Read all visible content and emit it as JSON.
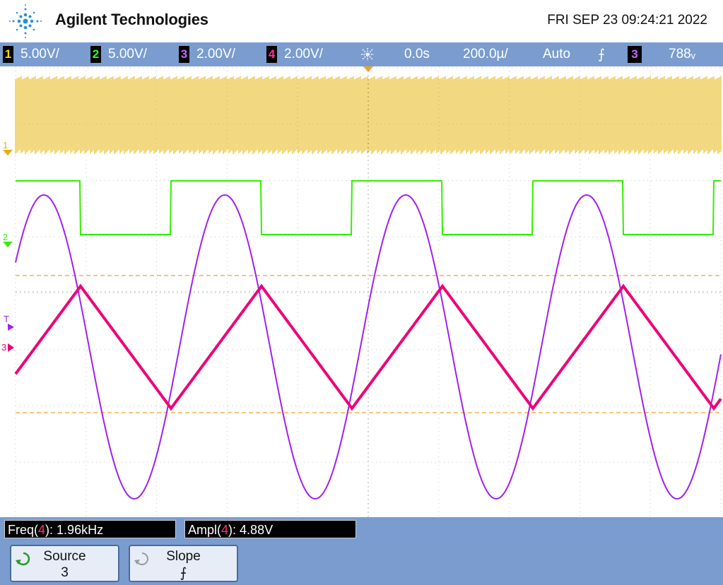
{
  "header": {
    "brand": "Agilent Technologies",
    "datetime": "FRI SEP 23 09:24:21 2022",
    "logo_icon": "agilent-spark-logo-icon"
  },
  "status_bar": {
    "channels": [
      {
        "number": "1",
        "scale": "5.00V/",
        "color": "#ffd21f"
      },
      {
        "number": "2",
        "scale": "5.00V/",
        "color": "#33ff33"
      },
      {
        "number": "3",
        "scale": "2.00V/",
        "color": "#cc66ff"
      },
      {
        "number": "4",
        "scale": "2.00V/",
        "color": "#ff3399"
      }
    ],
    "trigger_icon": "trigger-position-icon",
    "delay": "0.0s",
    "timebase": "200.0µ/",
    "mode": "Auto",
    "slope_symbol": "⨍",
    "trigger_channel": "3",
    "trigger_level": "788ᵥ"
  },
  "screen": {
    "markers": {
      "ch1": "1",
      "ch2": "2",
      "trigger": "T",
      "ch34": "3"
    },
    "colors": {
      "ch1": "#e6b000",
      "ch2": "#33ee00",
      "ch3": "#a020f0",
      "ch4": "#ee0077",
      "cursor": "#f0a030",
      "grid": "#c8c8c8"
    }
  },
  "measurements": [
    {
      "label_pre": "Freq(",
      "channel": "4",
      "label_post": "):",
      "value": "1.96kHz"
    },
    {
      "label_pre": "Ampl(",
      "channel": "4",
      "label_post": "):",
      "value": "4.88V"
    }
  ],
  "softkeys": [
    {
      "label": "Source",
      "value": "3",
      "icon": "rotate-knob-icon"
    },
    {
      "label": "Slope",
      "value": "⨍",
      "icon": "rotate-knob-icon"
    }
  ]
}
